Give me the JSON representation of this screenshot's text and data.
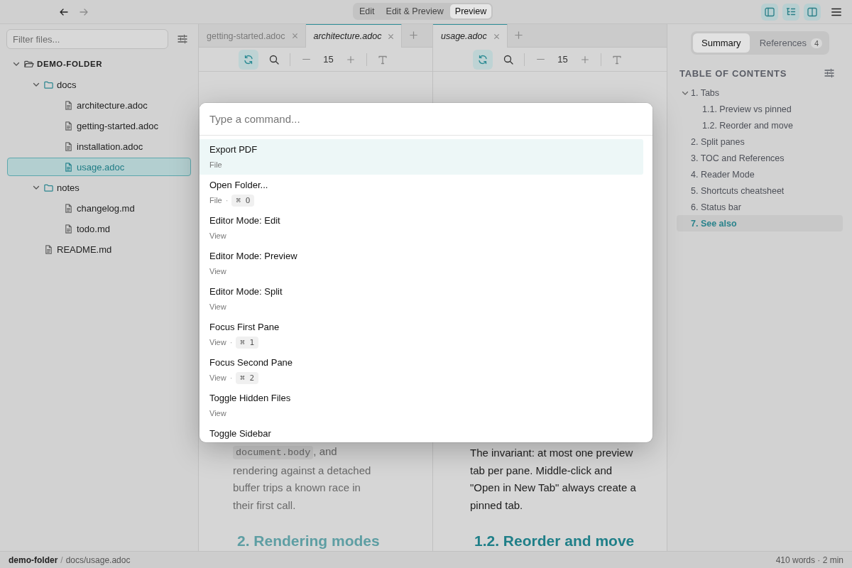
{
  "nav": [
    {
      "kind": "back",
      "disabled": false
    },
    {
      "kind": "forward",
      "disabled": true
    }
  ],
  "modes": [
    {
      "label": "Edit",
      "selected": false
    },
    {
      "label": "Edit & Preview",
      "selected": false
    },
    {
      "label": "Preview",
      "selected": true
    }
  ],
  "view_toggles": [
    {
      "kind": "sidebar",
      "on": true
    },
    {
      "kind": "outline",
      "on": true
    },
    {
      "kind": "split",
      "on": true
    }
  ],
  "sidebar": {
    "filter": {
      "placeholder": "Filter files..."
    },
    "tree": [
      {
        "name": "DEMO-FOLDER",
        "kind": "root",
        "expanded": true,
        "selected": false,
        "children": [
          {
            "name": "docs",
            "kind": "folder",
            "expanded": true,
            "selected": false,
            "children": [
              {
                "name": "architecture.adoc",
                "kind": "file",
                "selected": false
              },
              {
                "name": "getting-started.adoc",
                "kind": "file",
                "selected": false
              },
              {
                "name": "installation.adoc",
                "kind": "file",
                "selected": false
              },
              {
                "name": "usage.adoc",
                "kind": "file",
                "selected": true
              }
            ]
          },
          {
            "name": "notes",
            "kind": "folder",
            "expanded": true,
            "selected": false,
            "children": [
              {
                "name": "changelog.md",
                "kind": "file",
                "selected": false
              },
              {
                "name": "todo.md",
                "kind": "file",
                "selected": false
              }
            ]
          },
          {
            "name": "README.md",
            "kind": "file",
            "selected": false
          }
        ]
      }
    ]
  },
  "panes": [
    {
      "focused": false,
      "tabs": [
        {
          "label": "getting-started.adoc",
          "selected": false
        },
        {
          "label": "architecture.adoc",
          "selected": true
        }
      ],
      "toolbar": {
        "sync": true,
        "font_size": "15"
      },
      "content": [
        {
          "kind": "paragraph",
          "parts": [
            {
              "kind": "code",
              "text": "document.body"
            },
            {
              "kind": "text",
              "text": ", and rendering against a detached buffer trips a known race in their first call."
            }
          ]
        },
        {
          "kind": "heading",
          "text": "2. Rendering modes"
        }
      ]
    },
    {
      "focused": true,
      "tabs": [
        {
          "label": "usage.adoc",
          "selected": true
        }
      ],
      "toolbar": {
        "sync": true,
        "font_size": "15"
      },
      "content": [
        {
          "kind": "paragraph",
          "parts": [
            {
              "kind": "text",
              "text": "The invariant: at most one preview tab per pane. Middle-click and \"Open in New Tab\" always create a pinned tab."
            }
          ]
        },
        {
          "kind": "heading",
          "text": "1.2. Reorder and move"
        }
      ]
    }
  ],
  "outline": {
    "tabs": [
      {
        "label": "Summary",
        "selected": true
      },
      {
        "label": "References",
        "badge": "4",
        "selected": false
      }
    ],
    "title": "TABLE OF CONTENTS",
    "items": [
      {
        "label": "1. Tabs",
        "expanded": true,
        "selected": false,
        "children": [
          {
            "label": "1.1. Preview vs pinned",
            "selected": false
          },
          {
            "label": "1.2. Reorder and move",
            "selected": false
          }
        ]
      },
      {
        "label": "2. Split panes",
        "selected": false
      },
      {
        "label": "3. TOC and References",
        "selected": false
      },
      {
        "label": "4. Reader Mode",
        "selected": false
      },
      {
        "label": "5. Shortcuts cheatsheet",
        "selected": false
      },
      {
        "label": "6. Status bar",
        "selected": false
      },
      {
        "label": "7. See also",
        "selected": true
      }
    ]
  },
  "status_bar": {
    "folder": "demo-folder",
    "separator": "/",
    "path": "docs/usage.adoc",
    "stats": "410 words · 2 min"
  },
  "palette": {
    "placeholder": "Type a command...",
    "commands": [
      {
        "title": "Export PDF",
        "category": "File",
        "selected": true
      },
      {
        "title": "Open Folder...",
        "category": "File",
        "separator": "·",
        "shortcut": "⌘ O",
        "selected": false
      },
      {
        "title": "Editor Mode: Edit",
        "category": "View",
        "selected": false
      },
      {
        "title": "Editor Mode: Preview",
        "category": "View",
        "selected": false
      },
      {
        "title": "Editor Mode: Split",
        "category": "View",
        "selected": false
      },
      {
        "title": "Focus First Pane",
        "category": "View",
        "separator": "·",
        "shortcut": "⌘ 1",
        "selected": false
      },
      {
        "title": "Focus Second Pane",
        "category": "View",
        "separator": "·",
        "shortcut": "⌘ 2",
        "selected": false
      },
      {
        "title": "Toggle Hidden Files",
        "category": "View",
        "selected": false
      },
      {
        "title": "Toggle Sidebar",
        "selected": false
      }
    ]
  }
}
